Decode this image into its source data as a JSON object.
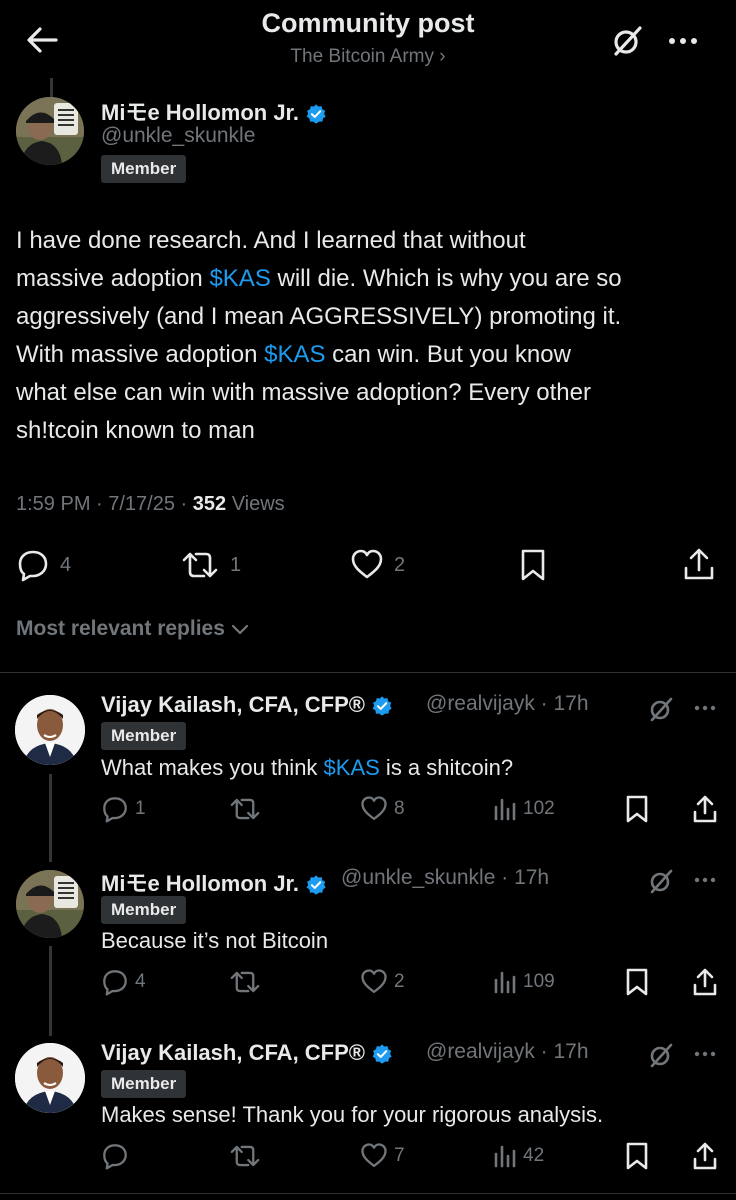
{
  "header": {
    "title": "Community post",
    "subtitle": "The Bitcoin Army ›"
  },
  "post": {
    "author_name": "Miモe Hollomon Jr.",
    "handle": "@unkle_skunkle",
    "badge": "Member",
    "text_lines": [
      "I have done research. And I learned that without",
      "massive adoption ",
      "$KAS",
      " will die. Which is why you are so",
      "aggressively (and I mean AGGRESSIVELY) promoting it.",
      "With massive adoption ",
      "$KAS",
      " can win. But you know",
      "what else can win with massive adoption? Every other",
      "sh!tcoin known to man"
    ],
    "time": "1:59 PM · 7/17/25 · ",
    "views_count": "352",
    "views_label": " Views",
    "replies": "4",
    "reposts": "1",
    "likes": "2"
  },
  "sort_label": "Most relevant replies",
  "replies": [
    {
      "name": "Vijay Kailash, CFA, CFP®",
      "handle": "@realvijayk · 17h",
      "badge": "Member",
      "text_pre": "What makes you think ",
      "text_tag": "$KAS",
      "text_post": " is a shitcoin?",
      "replies": "1",
      "reposts": "",
      "likes": "8",
      "views": "102"
    },
    {
      "name": "Miモe Hollomon Jr.",
      "handle": "@unkle_skunkle · 17h",
      "badge": "Member",
      "text_pre": "Because it’s not Bitcoin",
      "text_tag": "",
      "text_post": "",
      "replies": "4",
      "reposts": "",
      "likes": "2",
      "views": "109"
    },
    {
      "name": "Vijay Kailash, CFA, CFP®",
      "handle": "@realvijayk · 17h",
      "badge": "Member",
      "text_pre": "Makes sense! Thank you for your rigorous analysis.",
      "text_tag": "",
      "text_post": "",
      "replies": "",
      "reposts": "",
      "likes": "7",
      "views": "42"
    }
  ],
  "colors": {
    "background": "#000000",
    "text": "#e7e9ea",
    "muted": "#71767b",
    "accent": "#1d9bf0",
    "badge_bg": "#2f3336"
  }
}
